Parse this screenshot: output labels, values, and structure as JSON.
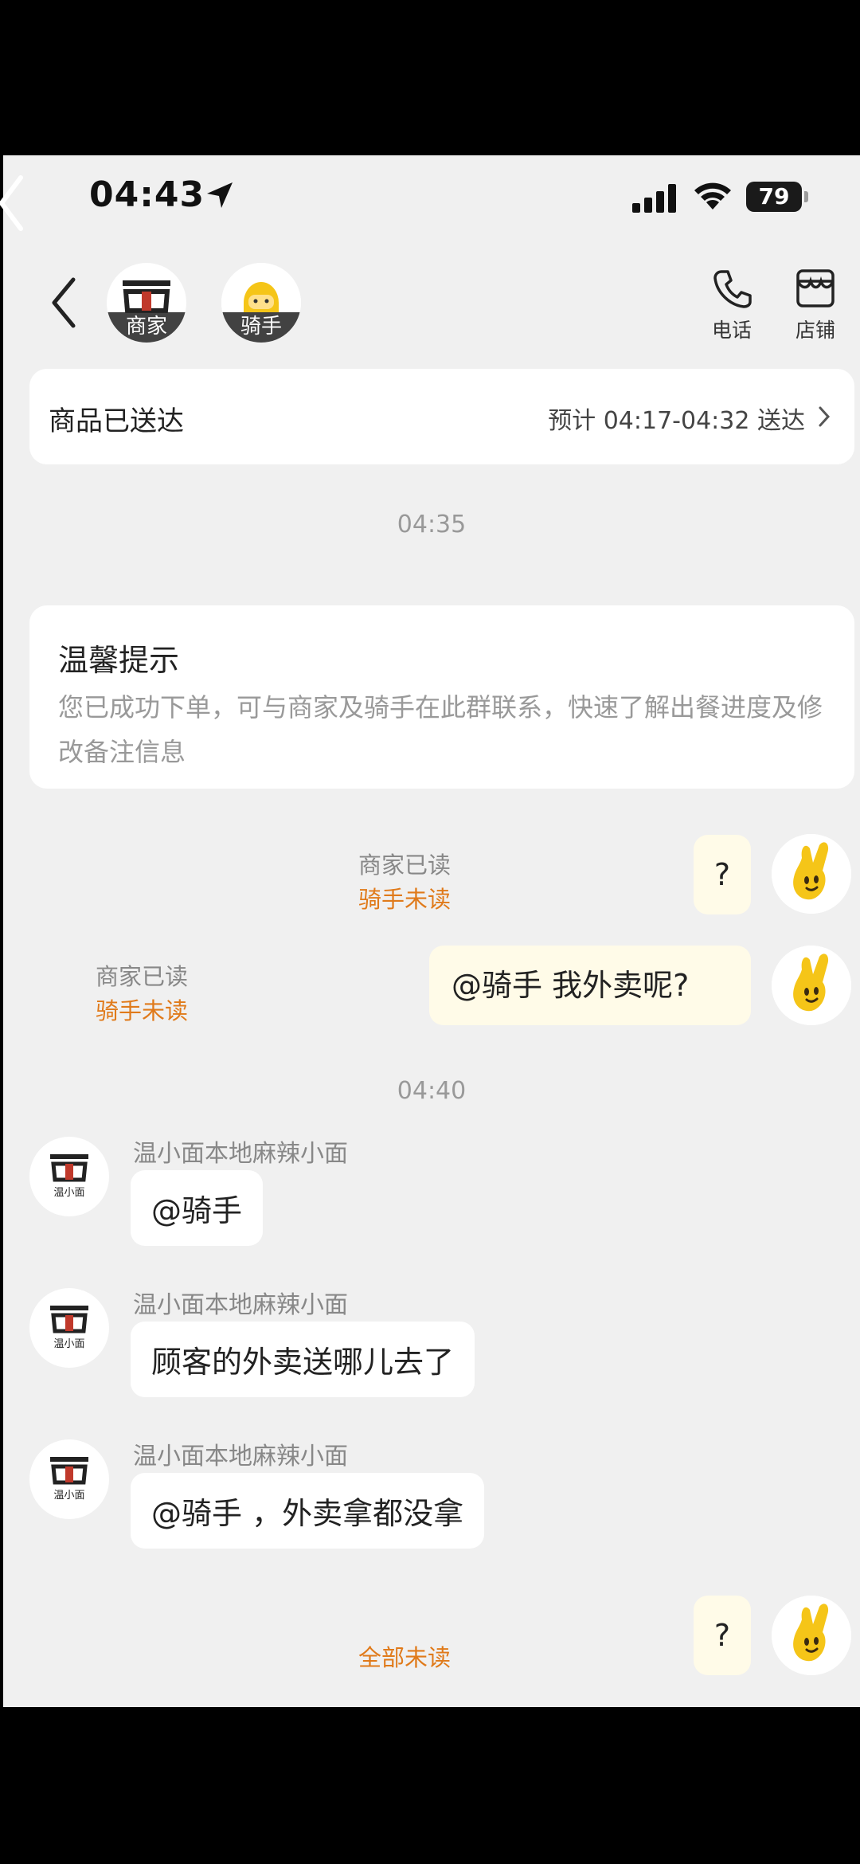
{
  "status_bar": {
    "time": "04:43",
    "battery": "79"
  },
  "header": {
    "merchant_label": "商家",
    "rider_label": "骑手",
    "phone_label": "电话",
    "store_label": "店铺"
  },
  "delivery": {
    "status": "商品已送达",
    "eta": "预计 04:17-04:32 送达"
  },
  "timestamps": [
    "04:35",
    "04:40"
  ],
  "tip": {
    "title": "温馨提示",
    "body": "您已成功下单，可与商家及骑手在此群联系，快速了解出餐进度及修改备注信息"
  },
  "messages": [
    {
      "from": "me",
      "text": "?",
      "merchant_read": "商家已读",
      "rider_read": "骑手未读"
    },
    {
      "from": "me",
      "text": "@骑手 我外卖呢?",
      "merchant_read": "商家已读",
      "rider_read": "骑手未读"
    },
    {
      "from": "shop",
      "sender": "温小面本地麻辣小面",
      "text": "@骑手"
    },
    {
      "from": "shop",
      "sender": "温小面本地麻辣小面",
      "text": "顾客的外卖送哪儿去了"
    },
    {
      "from": "shop",
      "sender": "温小面本地麻辣小面",
      "text": "@骑手 ，外卖拿都没拿"
    },
    {
      "from": "me",
      "text": "?",
      "all_read": "全部未读"
    }
  ],
  "shop_logo_text": "温小面",
  "colors": {
    "unread_orange": "#e07a1a",
    "my_bubble": "#fffbe8",
    "avatar_yellow": "#f5c518"
  }
}
